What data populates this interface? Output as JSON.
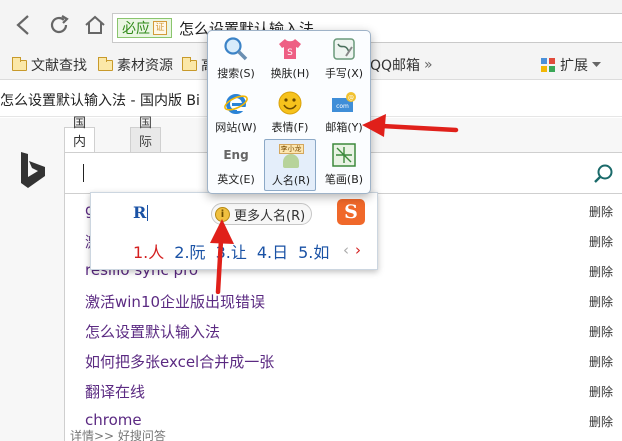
{
  "browser": {
    "secure_label": "必应",
    "cert_glyph": "证",
    "url_text": "怎么设置默认输入法"
  },
  "bookmarks": [
    {
      "label": "文献查找"
    },
    {
      "label": "素材资源"
    },
    {
      "label": "高"
    },
    {
      "label": "QQ邮箱"
    }
  ],
  "bookmarks_more": "»",
  "extensions_label": "扩展",
  "tab_title": "怎么设置默认输入法 - 国内版 Bi",
  "bing": {
    "scope_tabs": [
      "国内版",
      "国际版"
    ],
    "search_value": ""
  },
  "suggestions": [
    {
      "text": "g",
      "delete": "删除"
    },
    {
      "text": "激",
      "delete": "删除"
    },
    {
      "text": "resilio sync pro",
      "delete": "删除"
    },
    {
      "text": "激活win10企业版出现错误",
      "delete": "删除"
    },
    {
      "text": "怎么设置默认输入法",
      "delete": "删除"
    },
    {
      "text": "如何把多张excel合并成一张",
      "delete": "删除"
    },
    {
      "text": "翻译在线",
      "delete": "删除"
    },
    {
      "text": "chrome",
      "delete": "删除"
    }
  ],
  "partial_text": "详情>> 好搜问答",
  "ime": {
    "input": "R",
    "more_names_label": "更多人名(R)",
    "info_glyph": "i",
    "logo_glyph": "S",
    "candidates": [
      "1.人",
      "2.阮",
      "3.让",
      "4.日",
      "5.如"
    ],
    "prev_glyph": "‹",
    "next_glyph": "›"
  },
  "toolbox": {
    "tools": [
      {
        "label": "搜索(S)",
        "icon": "magnifier-icon"
      },
      {
        "label": "换肤(H)",
        "icon": "tshirt-icon"
      },
      {
        "label": "手写(X)",
        "icon": "handwriting-icon"
      },
      {
        "label": "网站(W)",
        "icon": "ie-icon"
      },
      {
        "label": "表情(F)",
        "icon": "smiley-icon"
      },
      {
        "label": "邮箱(Y)",
        "icon": "mail-icon"
      },
      {
        "label": "英文(E)",
        "icon": "english-icon"
      },
      {
        "label": "人名(R)",
        "icon": "name-card-icon"
      },
      {
        "label": "笔画(B)",
        "icon": "stroke-icon"
      }
    ],
    "name_card_text": "李小龙",
    "english_glyph": "Eng",
    "selected_index": 7
  },
  "colors": {
    "annotation_arrow": "#e0201a",
    "link_purple": "#5b2a82",
    "candidate_blue": "#1a52a5"
  }
}
